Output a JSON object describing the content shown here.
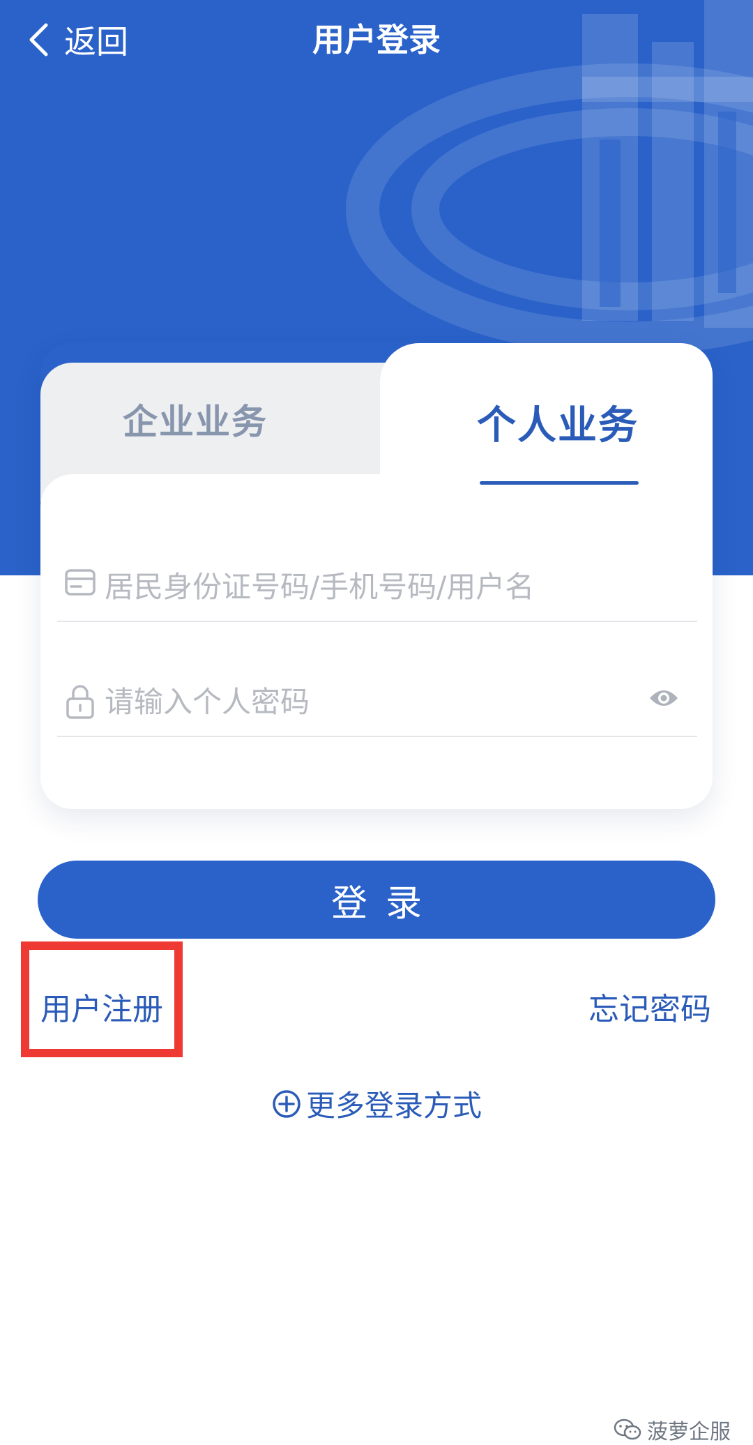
{
  "header": {
    "back_label": "返回",
    "title": "用户登录"
  },
  "tabs": [
    {
      "label": "企业业务",
      "active": false
    },
    {
      "label": "个人业务",
      "active": true
    }
  ],
  "form": {
    "id_field": {
      "placeholder": "居民身份证号码/手机号码/用户名",
      "value": ""
    },
    "password_field": {
      "placeholder": "请输入个人密码",
      "value": ""
    }
  },
  "actions": {
    "login_label": "登录",
    "register_label": "用户注册",
    "forgot_label": "忘记密码",
    "more_login_label": "更多登录方式"
  },
  "watermark": {
    "text": "菠萝企服"
  },
  "colors": {
    "brand_blue": "#2a62c9",
    "link_blue": "#2a5bb8",
    "highlight_red": "#ee3a33",
    "inactive_tab_text": "#8795ad"
  },
  "icons": [
    "chevron-left-icon",
    "id-card-icon",
    "lock-icon",
    "eye-icon",
    "plus-circle-icon",
    "wechat-icon"
  ]
}
